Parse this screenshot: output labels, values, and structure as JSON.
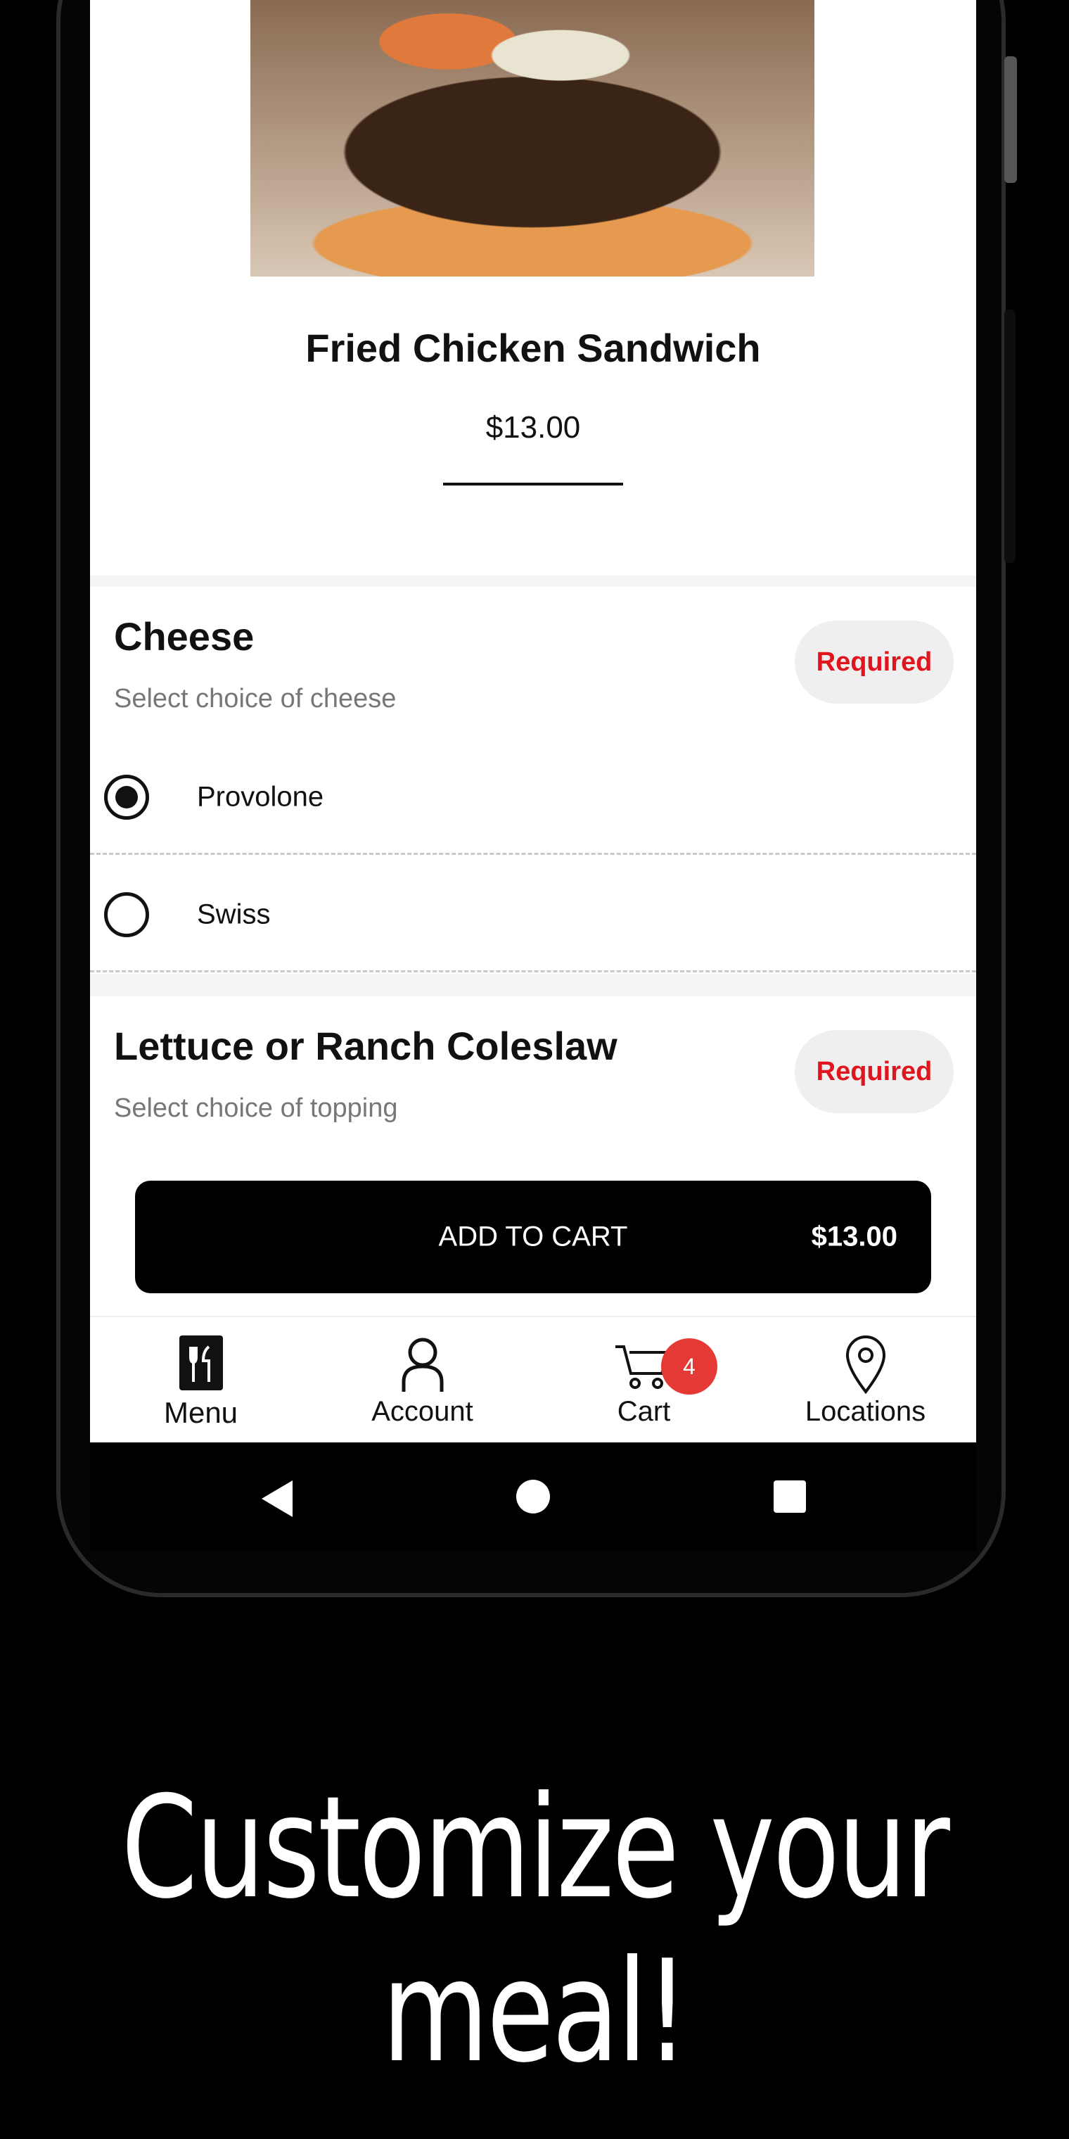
{
  "product": {
    "image_alt": "Fried chicken sandwich photo",
    "title": "Fried Chicken Sandwich",
    "price": "$13.00"
  },
  "groups": [
    {
      "title": "Cheese",
      "subtitle": "Select choice of cheese",
      "badge": "Required",
      "options": [
        {
          "label": "Provolone",
          "selected": true
        },
        {
          "label": "Swiss",
          "selected": false
        }
      ]
    },
    {
      "title": "Lettuce or Ranch Coleslaw",
      "subtitle": "Select choice of topping",
      "badge": "Required"
    }
  ],
  "cart_button": {
    "label": "ADD TO CART",
    "amount": "$13.00"
  },
  "tabs": [
    {
      "label": "Menu",
      "icon": "menu-icon"
    },
    {
      "label": "Account",
      "icon": "account-icon"
    },
    {
      "label": "Cart",
      "icon": "cart-icon",
      "badge": "4"
    },
    {
      "label": "Locations",
      "icon": "location-pin-icon"
    }
  ],
  "caption": "Customize your meal!",
  "colors": {
    "accent": "#e0161f",
    "badge": "#e53935"
  }
}
